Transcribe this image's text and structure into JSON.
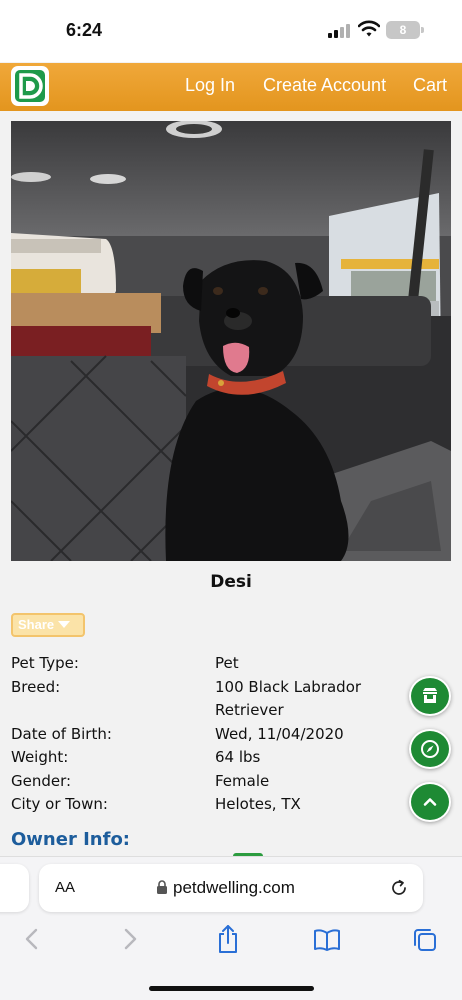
{
  "status_bar": {
    "time": "6:24",
    "battery": "8"
  },
  "header": {
    "logo_icon": "petdwelling-logo",
    "nav": [
      "Log In",
      "Create Account",
      "Cart"
    ]
  },
  "pet": {
    "name": "Desi",
    "share_label": "Share",
    "details": [
      {
        "label": "Pet Type:",
        "value": "Pet"
      },
      {
        "label": "Breed:",
        "value": "100 Black Labrador Retriever"
      },
      {
        "label": "Date of Birth:",
        "value": "Wed, 11/04/2020"
      },
      {
        "label": "Weight:",
        "value": "64 lbs"
      },
      {
        "label": "Gender:",
        "value": "Female"
      },
      {
        "label": "City or Town:",
        "value": "Helotes, TX"
      }
    ]
  },
  "owner": {
    "title": "Owner Info:"
  },
  "fabs": [
    "store-icon",
    "compass-icon",
    "chevron-up-icon"
  ],
  "browser": {
    "text_size_label": "AA",
    "url": "petdwelling.com",
    "toolbar": [
      "back-icon",
      "forward-icon",
      "share-icon",
      "bookmarks-icon",
      "tabs-icon"
    ]
  },
  "colors": {
    "header": "#e9a030",
    "accent_green": "#1e8a34",
    "owner_title": "#1d5d9c"
  }
}
